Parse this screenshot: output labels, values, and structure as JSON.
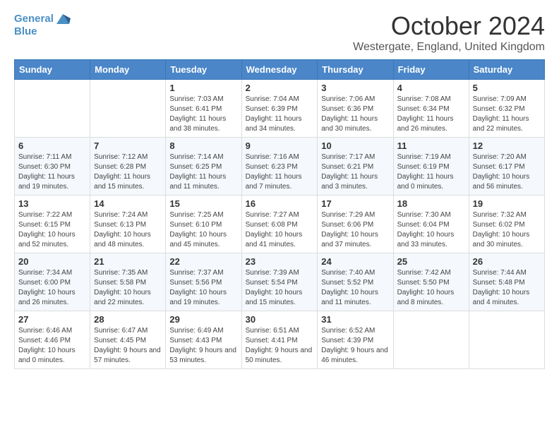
{
  "logo": {
    "line1": "General",
    "line2": "Blue"
  },
  "title": "October 2024",
  "location": "Westergate, England, United Kingdom",
  "days_of_week": [
    "Sunday",
    "Monday",
    "Tuesday",
    "Wednesday",
    "Thursday",
    "Friday",
    "Saturday"
  ],
  "weeks": [
    [
      {
        "day": "",
        "info": ""
      },
      {
        "day": "",
        "info": ""
      },
      {
        "day": "1",
        "info": "Sunrise: 7:03 AM\nSunset: 6:41 PM\nDaylight: 11 hours and 38 minutes."
      },
      {
        "day": "2",
        "info": "Sunrise: 7:04 AM\nSunset: 6:39 PM\nDaylight: 11 hours and 34 minutes."
      },
      {
        "day": "3",
        "info": "Sunrise: 7:06 AM\nSunset: 6:36 PM\nDaylight: 11 hours and 30 minutes."
      },
      {
        "day": "4",
        "info": "Sunrise: 7:08 AM\nSunset: 6:34 PM\nDaylight: 11 hours and 26 minutes."
      },
      {
        "day": "5",
        "info": "Sunrise: 7:09 AM\nSunset: 6:32 PM\nDaylight: 11 hours and 22 minutes."
      }
    ],
    [
      {
        "day": "6",
        "info": "Sunrise: 7:11 AM\nSunset: 6:30 PM\nDaylight: 11 hours and 19 minutes."
      },
      {
        "day": "7",
        "info": "Sunrise: 7:12 AM\nSunset: 6:28 PM\nDaylight: 11 hours and 15 minutes."
      },
      {
        "day": "8",
        "info": "Sunrise: 7:14 AM\nSunset: 6:25 PM\nDaylight: 11 hours and 11 minutes."
      },
      {
        "day": "9",
        "info": "Sunrise: 7:16 AM\nSunset: 6:23 PM\nDaylight: 11 hours and 7 minutes."
      },
      {
        "day": "10",
        "info": "Sunrise: 7:17 AM\nSunset: 6:21 PM\nDaylight: 11 hours and 3 minutes."
      },
      {
        "day": "11",
        "info": "Sunrise: 7:19 AM\nSunset: 6:19 PM\nDaylight: 11 hours and 0 minutes."
      },
      {
        "day": "12",
        "info": "Sunrise: 7:20 AM\nSunset: 6:17 PM\nDaylight: 10 hours and 56 minutes."
      }
    ],
    [
      {
        "day": "13",
        "info": "Sunrise: 7:22 AM\nSunset: 6:15 PM\nDaylight: 10 hours and 52 minutes."
      },
      {
        "day": "14",
        "info": "Sunrise: 7:24 AM\nSunset: 6:13 PM\nDaylight: 10 hours and 48 minutes."
      },
      {
        "day": "15",
        "info": "Sunrise: 7:25 AM\nSunset: 6:10 PM\nDaylight: 10 hours and 45 minutes."
      },
      {
        "day": "16",
        "info": "Sunrise: 7:27 AM\nSunset: 6:08 PM\nDaylight: 10 hours and 41 minutes."
      },
      {
        "day": "17",
        "info": "Sunrise: 7:29 AM\nSunset: 6:06 PM\nDaylight: 10 hours and 37 minutes."
      },
      {
        "day": "18",
        "info": "Sunrise: 7:30 AM\nSunset: 6:04 PM\nDaylight: 10 hours and 33 minutes."
      },
      {
        "day": "19",
        "info": "Sunrise: 7:32 AM\nSunset: 6:02 PM\nDaylight: 10 hours and 30 minutes."
      }
    ],
    [
      {
        "day": "20",
        "info": "Sunrise: 7:34 AM\nSunset: 6:00 PM\nDaylight: 10 hours and 26 minutes."
      },
      {
        "day": "21",
        "info": "Sunrise: 7:35 AM\nSunset: 5:58 PM\nDaylight: 10 hours and 22 minutes."
      },
      {
        "day": "22",
        "info": "Sunrise: 7:37 AM\nSunset: 5:56 PM\nDaylight: 10 hours and 19 minutes."
      },
      {
        "day": "23",
        "info": "Sunrise: 7:39 AM\nSunset: 5:54 PM\nDaylight: 10 hours and 15 minutes."
      },
      {
        "day": "24",
        "info": "Sunrise: 7:40 AM\nSunset: 5:52 PM\nDaylight: 10 hours and 11 minutes."
      },
      {
        "day": "25",
        "info": "Sunrise: 7:42 AM\nSunset: 5:50 PM\nDaylight: 10 hours and 8 minutes."
      },
      {
        "day": "26",
        "info": "Sunrise: 7:44 AM\nSunset: 5:48 PM\nDaylight: 10 hours and 4 minutes."
      }
    ],
    [
      {
        "day": "27",
        "info": "Sunrise: 6:46 AM\nSunset: 4:46 PM\nDaylight: 10 hours and 0 minutes."
      },
      {
        "day": "28",
        "info": "Sunrise: 6:47 AM\nSunset: 4:45 PM\nDaylight: 9 hours and 57 minutes."
      },
      {
        "day": "29",
        "info": "Sunrise: 6:49 AM\nSunset: 4:43 PM\nDaylight: 9 hours and 53 minutes."
      },
      {
        "day": "30",
        "info": "Sunrise: 6:51 AM\nSunset: 4:41 PM\nDaylight: 9 hours and 50 minutes."
      },
      {
        "day": "31",
        "info": "Sunrise: 6:52 AM\nSunset: 4:39 PM\nDaylight: 9 hours and 46 minutes."
      },
      {
        "day": "",
        "info": ""
      },
      {
        "day": "",
        "info": ""
      }
    ]
  ]
}
